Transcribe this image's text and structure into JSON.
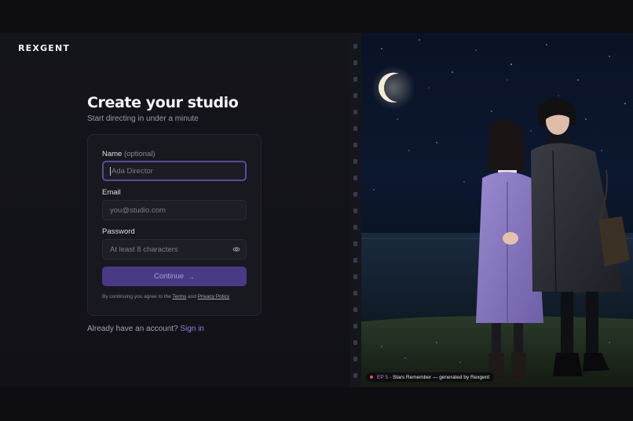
{
  "brand": {
    "logo_text": "REXGENT"
  },
  "form": {
    "title": "Create your studio",
    "subtitle": "Start directing in under a minute",
    "name_label": "Name",
    "name_optional": "(optional)",
    "name_placeholder": "Ada Director",
    "email_label": "Email",
    "email_placeholder": "you@studio.com",
    "password_label": "Password",
    "password_placeholder": "At least 8 characters",
    "continue_label": "Continue",
    "legal_prefix": "By continuing you agree to the",
    "terms_label": "Terms",
    "legal_and": "and",
    "privacy_label": "Privacy Policy"
  },
  "signin": {
    "prompt": "Already have an account?",
    "link": "Sign in"
  },
  "hero": {
    "caption_ep": "EP 5",
    "caption_text": "· Stars Remember — generated by Rexgent"
  },
  "icons": {
    "eye": "eye-icon",
    "arrow": "arrow-right-icon",
    "moon": "moon-icon"
  },
  "colors": {
    "accent": "#4a3a86",
    "link": "#9b7bea",
    "focus_border": "#5a4a9a"
  }
}
